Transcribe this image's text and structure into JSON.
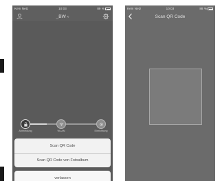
{
  "left_screen": {
    "status_bar": {
      "carrier": "Kein Netz",
      "time": "10:03",
      "battery": "89 %"
    },
    "nav": {
      "title": "_BW"
    },
    "stepper": {
      "steps": [
        {
          "label": "Anmeldung",
          "state": "active"
        },
        {
          "label": "WLAN",
          "state": "inactive"
        },
        {
          "label": "Einrichtung",
          "state": "inactive"
        }
      ]
    },
    "action_sheet": {
      "scan_qr_label": "Scan QR Code",
      "scan_photo_label": "Scan QR Code von Fotoalbum",
      "cancel_label": "verlassen"
    }
  },
  "right_screen": {
    "status_bar": {
      "carrier": "Kein Netz",
      "time": "10:03",
      "battery": "88 %"
    },
    "nav": {
      "title": "Scan QR Code"
    }
  }
}
